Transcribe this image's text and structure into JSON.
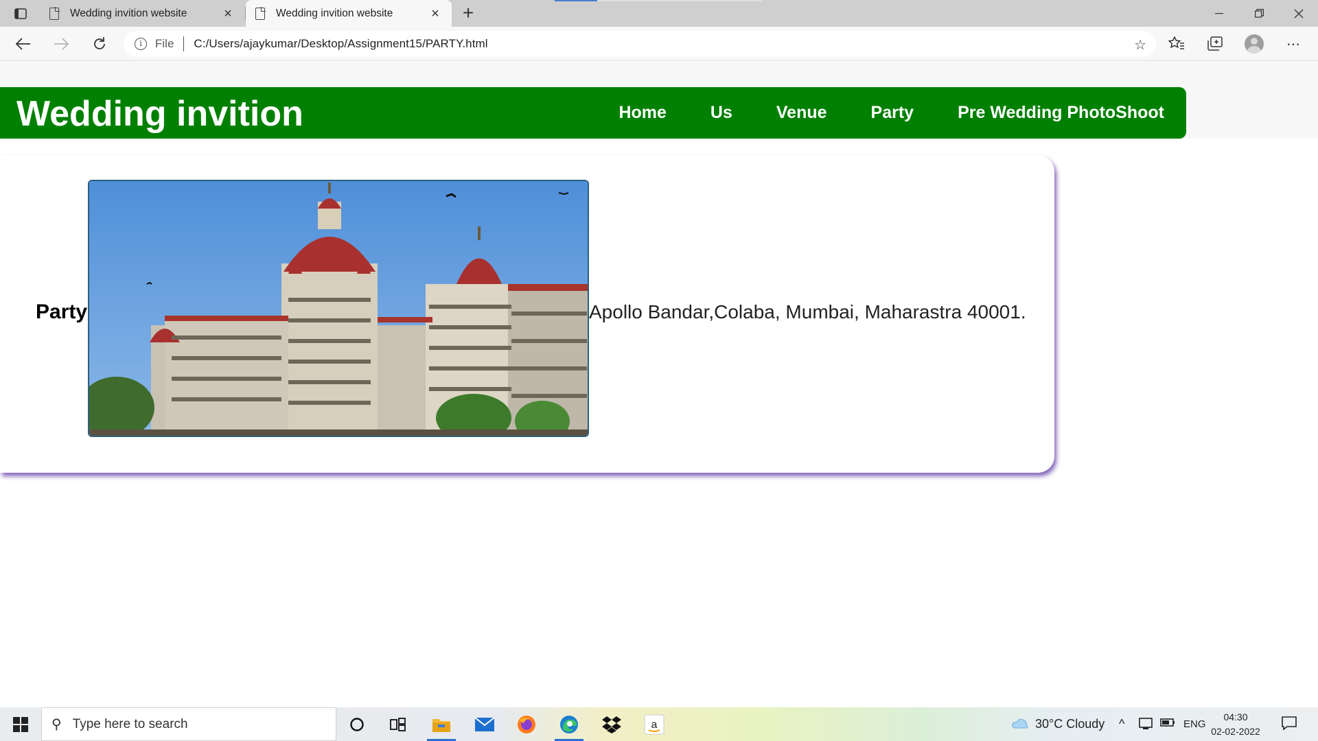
{
  "browser": {
    "tabs": [
      {
        "title": "Wedding invition website",
        "active": false
      },
      {
        "title": "Wedding invition website",
        "active": true
      }
    ],
    "address_label": "File",
    "url": "C:/Users/ajaykumar/Desktop/Assignment15/PARTY.html"
  },
  "site": {
    "title": "Wedding invition",
    "nav": [
      "Home",
      "Us",
      "Venue",
      "Party",
      "Pre Wedding PhotoShoot"
    ],
    "header_color": "#008000"
  },
  "party": {
    "label": "Party",
    "address": "Apollo Bandar,Colaba, Mumbai, Maharastra 40001."
  },
  "taskbar": {
    "search_placeholder": "Type here to search",
    "weather": "30°C  Cloudy",
    "language": "ENG",
    "time": "04:30",
    "date": "02-02-2022"
  }
}
